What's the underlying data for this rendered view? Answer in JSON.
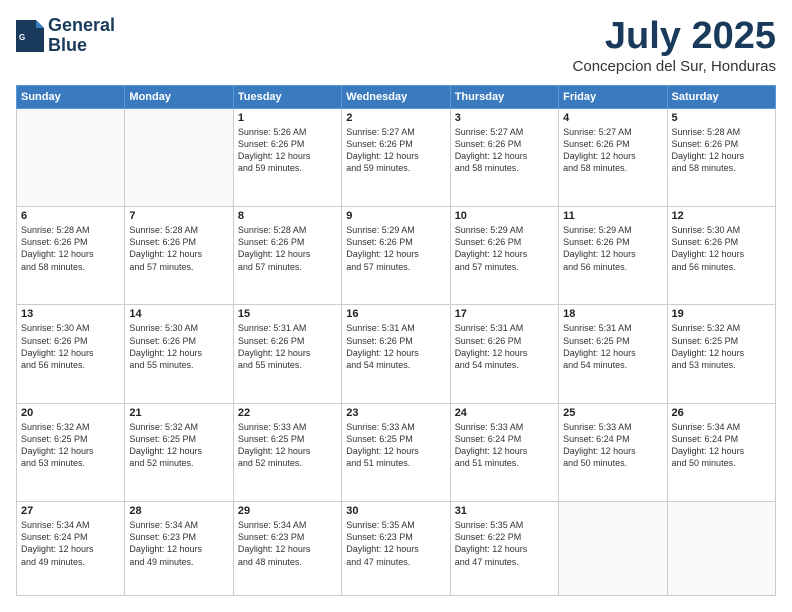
{
  "header": {
    "logo_line1": "General",
    "logo_line2": "Blue",
    "month": "July 2025",
    "location": "Concepcion del Sur, Honduras"
  },
  "weekdays": [
    "Sunday",
    "Monday",
    "Tuesday",
    "Wednesday",
    "Thursday",
    "Friday",
    "Saturday"
  ],
  "weeks": [
    [
      {
        "day": "",
        "info": ""
      },
      {
        "day": "",
        "info": ""
      },
      {
        "day": "1",
        "info": "Sunrise: 5:26 AM\nSunset: 6:26 PM\nDaylight: 12 hours\nand 59 minutes."
      },
      {
        "day": "2",
        "info": "Sunrise: 5:27 AM\nSunset: 6:26 PM\nDaylight: 12 hours\nand 59 minutes."
      },
      {
        "day": "3",
        "info": "Sunrise: 5:27 AM\nSunset: 6:26 PM\nDaylight: 12 hours\nand 58 minutes."
      },
      {
        "day": "4",
        "info": "Sunrise: 5:27 AM\nSunset: 6:26 PM\nDaylight: 12 hours\nand 58 minutes."
      },
      {
        "day": "5",
        "info": "Sunrise: 5:28 AM\nSunset: 6:26 PM\nDaylight: 12 hours\nand 58 minutes."
      }
    ],
    [
      {
        "day": "6",
        "info": "Sunrise: 5:28 AM\nSunset: 6:26 PM\nDaylight: 12 hours\nand 58 minutes."
      },
      {
        "day": "7",
        "info": "Sunrise: 5:28 AM\nSunset: 6:26 PM\nDaylight: 12 hours\nand 57 minutes."
      },
      {
        "day": "8",
        "info": "Sunrise: 5:28 AM\nSunset: 6:26 PM\nDaylight: 12 hours\nand 57 minutes."
      },
      {
        "day": "9",
        "info": "Sunrise: 5:29 AM\nSunset: 6:26 PM\nDaylight: 12 hours\nand 57 minutes."
      },
      {
        "day": "10",
        "info": "Sunrise: 5:29 AM\nSunset: 6:26 PM\nDaylight: 12 hours\nand 57 minutes."
      },
      {
        "day": "11",
        "info": "Sunrise: 5:29 AM\nSunset: 6:26 PM\nDaylight: 12 hours\nand 56 minutes."
      },
      {
        "day": "12",
        "info": "Sunrise: 5:30 AM\nSunset: 6:26 PM\nDaylight: 12 hours\nand 56 minutes."
      }
    ],
    [
      {
        "day": "13",
        "info": "Sunrise: 5:30 AM\nSunset: 6:26 PM\nDaylight: 12 hours\nand 56 minutes."
      },
      {
        "day": "14",
        "info": "Sunrise: 5:30 AM\nSunset: 6:26 PM\nDaylight: 12 hours\nand 55 minutes."
      },
      {
        "day": "15",
        "info": "Sunrise: 5:31 AM\nSunset: 6:26 PM\nDaylight: 12 hours\nand 55 minutes."
      },
      {
        "day": "16",
        "info": "Sunrise: 5:31 AM\nSunset: 6:26 PM\nDaylight: 12 hours\nand 54 minutes."
      },
      {
        "day": "17",
        "info": "Sunrise: 5:31 AM\nSunset: 6:26 PM\nDaylight: 12 hours\nand 54 minutes."
      },
      {
        "day": "18",
        "info": "Sunrise: 5:31 AM\nSunset: 6:25 PM\nDaylight: 12 hours\nand 54 minutes."
      },
      {
        "day": "19",
        "info": "Sunrise: 5:32 AM\nSunset: 6:25 PM\nDaylight: 12 hours\nand 53 minutes."
      }
    ],
    [
      {
        "day": "20",
        "info": "Sunrise: 5:32 AM\nSunset: 6:25 PM\nDaylight: 12 hours\nand 53 minutes."
      },
      {
        "day": "21",
        "info": "Sunrise: 5:32 AM\nSunset: 6:25 PM\nDaylight: 12 hours\nand 52 minutes."
      },
      {
        "day": "22",
        "info": "Sunrise: 5:33 AM\nSunset: 6:25 PM\nDaylight: 12 hours\nand 52 minutes."
      },
      {
        "day": "23",
        "info": "Sunrise: 5:33 AM\nSunset: 6:25 PM\nDaylight: 12 hours\nand 51 minutes."
      },
      {
        "day": "24",
        "info": "Sunrise: 5:33 AM\nSunset: 6:24 PM\nDaylight: 12 hours\nand 51 minutes."
      },
      {
        "day": "25",
        "info": "Sunrise: 5:33 AM\nSunset: 6:24 PM\nDaylight: 12 hours\nand 50 minutes."
      },
      {
        "day": "26",
        "info": "Sunrise: 5:34 AM\nSunset: 6:24 PM\nDaylight: 12 hours\nand 50 minutes."
      }
    ],
    [
      {
        "day": "27",
        "info": "Sunrise: 5:34 AM\nSunset: 6:24 PM\nDaylight: 12 hours\nand 49 minutes."
      },
      {
        "day": "28",
        "info": "Sunrise: 5:34 AM\nSunset: 6:23 PM\nDaylight: 12 hours\nand 49 minutes."
      },
      {
        "day": "29",
        "info": "Sunrise: 5:34 AM\nSunset: 6:23 PM\nDaylight: 12 hours\nand 48 minutes."
      },
      {
        "day": "30",
        "info": "Sunrise: 5:35 AM\nSunset: 6:23 PM\nDaylight: 12 hours\nand 47 minutes."
      },
      {
        "day": "31",
        "info": "Sunrise: 5:35 AM\nSunset: 6:22 PM\nDaylight: 12 hours\nand 47 minutes."
      },
      {
        "day": "",
        "info": ""
      },
      {
        "day": "",
        "info": ""
      }
    ]
  ]
}
